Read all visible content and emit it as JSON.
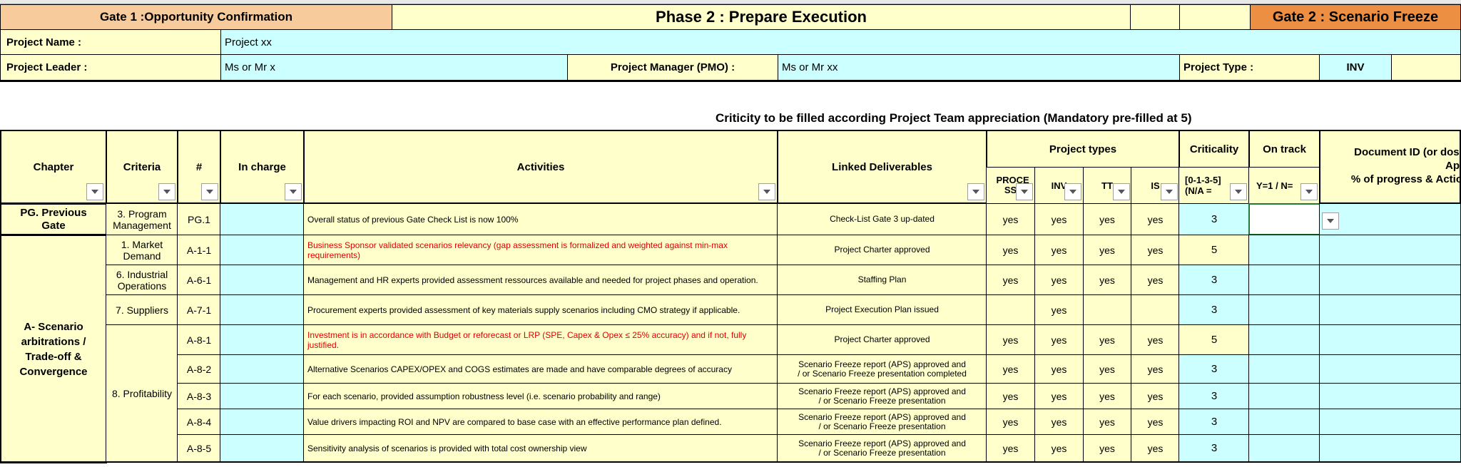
{
  "top": {
    "gate1": "Gate 1 :Opportunity Confirmation",
    "phase": "Phase 2 : Prepare Execution",
    "gate2": "Gate 2 : Scenario Freeze"
  },
  "project": {
    "name_label": "Project Name :",
    "name_value": "Project xx",
    "leader_label": "Project Leader :",
    "leader_value": "Ms or Mr  x",
    "manager_label": "Project Manager (PMO) :",
    "manager_value": "Ms or Mr xx",
    "type_label": "Project Type :",
    "type_value": "INV"
  },
  "criticity_note": "Criticity to be filled according Project Team appreciation (Mandatory pre-filled at 5)",
  "headers": {
    "chapter": "Chapter",
    "criteria": "Criteria",
    "num": "#",
    "in_charge": "In charge",
    "activities": "Activities",
    "linked": "Linked Deliverables",
    "project_types": "Project types",
    "proc": "PROCE SS",
    "inv": "INV",
    "tt": "TT",
    "is": "IS",
    "criticality": "Criticality",
    "criticality_sub": "[0-1-3-5] (N/A =",
    "on_track": "On track",
    "on_track_sub": "Y=1 / N=",
    "docid": "Document ID (or doss",
    "docid_2": "Ap",
    "docid_sub": "% of progress & Actio"
  },
  "chapters": {
    "pg": "PG. Previous Gate",
    "a": "A- Scenario arbitrations / Trade-off & Convergence"
  },
  "rows": [
    {
      "criteria": "3. Program Management",
      "num": "PG.1",
      "activity": "Overall status of previous Gate Check List is now 100%",
      "red": false,
      "deliverable": "Check-List Gate 3 up-dated",
      "p": "yes",
      "i": "yes",
      "t": "yes",
      "s": "yes",
      "crit": "3"
    },
    {
      "criteria": "1. Market Demand",
      "num": "A-1-1",
      "activity": "Business Sponsor validated scenarios relevancy (gap assessment is formalized and weighted against min-max requirements)",
      "red": true,
      "deliverable": "Project Charter approved",
      "p": "yes",
      "i": "yes",
      "t": "yes",
      "s": "yes",
      "crit": "5"
    },
    {
      "criteria": "6. Industrial Operations",
      "num": "A-6-1",
      "activity": "Management and HR experts provided assessment ressources available and needed for project phases and operation.",
      "red": false,
      "deliverable": "Staffing Plan",
      "p": "yes",
      "i": "yes",
      "t": "yes",
      "s": "yes",
      "crit": "3"
    },
    {
      "criteria": "7. Suppliers",
      "num": "A-7-1",
      "activity": "Procurement experts provided assessment of key materials supply scenarios including CMO strategy if applicable.",
      "red": false,
      "deliverable": "Project Execution Plan issued",
      "p": "",
      "i": "yes",
      "t": "",
      "s": "",
      "crit": "3"
    },
    {
      "criteria": "8. Profitability",
      "num": "A-8-1",
      "activity": "Investment is in accordance with Budget or reforecast or LRP (SPE,  Capex & Opex ≤ 25% accuracy) and if not, fully justified.",
      "red": true,
      "deliverable": "Project Charter approved",
      "p": "yes",
      "i": "yes",
      "t": "yes",
      "s": "yes",
      "crit": "5"
    },
    {
      "criteria": "",
      "num": "A-8-2",
      "activity": "Alternative Scenarios CAPEX/OPEX and COGS estimates are made and have comparable degrees of accuracy",
      "red": false,
      "deliverable": "Scenario Freeze report (APS) approved and / or Scenario Freeze presentation completed",
      "p": "yes",
      "i": "yes",
      "t": "yes",
      "s": "yes",
      "crit": "3"
    },
    {
      "criteria": "",
      "num": "A-8-3",
      "activity": "For each scenario, provided assumption robustness level (i.e. scenario probability and range)",
      "red": false,
      "deliverable": "Scenario Freeze report (APS) approved and / or Scenario Freeze presentation",
      "p": "yes",
      "i": "yes",
      "t": "yes",
      "s": "yes",
      "crit": "3"
    },
    {
      "criteria": "",
      "num": "A-8-4",
      "activity": "Value drivers impacting ROI and NPV are compared to base case with an effective performance plan defined.",
      "red": false,
      "deliverable": "Scenario Freeze report (APS) approved and / or Scenario Freeze presentation",
      "p": "yes",
      "i": "yes",
      "t": "yes",
      "s": "yes",
      "crit": "3"
    },
    {
      "criteria": "",
      "num": "A-8-5",
      "activity": "Sensitivity analysis of scenarios is provided with total cost ownership view",
      "red": false,
      "deliverable": "Scenario Freeze report (APS) approved and / or Scenario Freeze presentation",
      "p": "yes",
      "i": "yes",
      "t": "yes",
      "s": "yes",
      "crit": "3"
    }
  ]
}
